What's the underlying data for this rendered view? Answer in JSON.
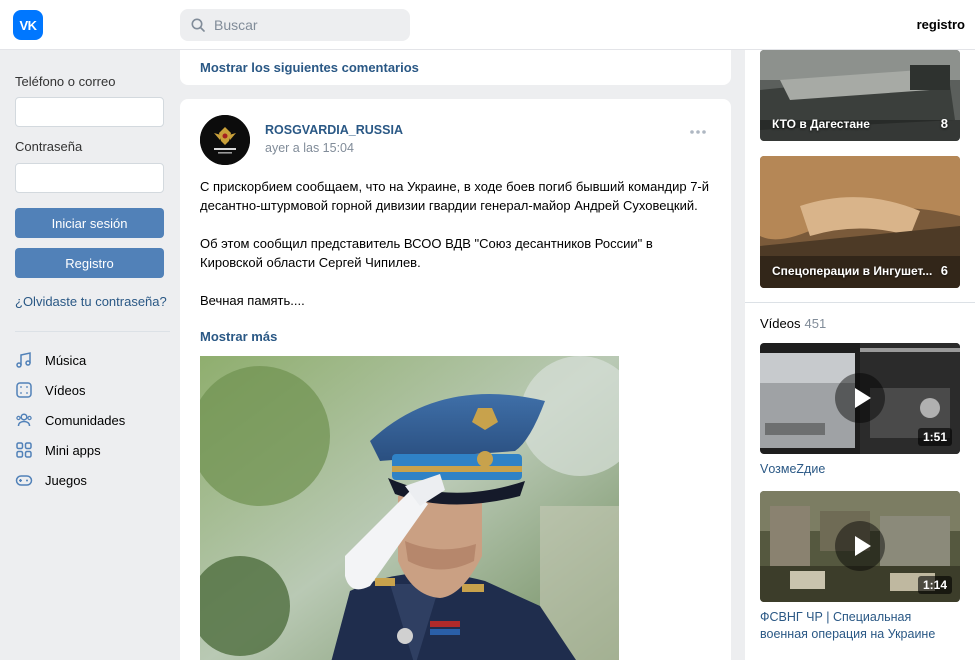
{
  "header": {
    "logo_text": "VK",
    "search_placeholder": "Buscar",
    "register_link": "registro"
  },
  "login": {
    "phone_label": "Teléfono o correo",
    "password_label": "Contraseña",
    "login_button": "Iniciar sesión",
    "register_button": "Registro",
    "forgot_link": "¿Olvidaste tu contraseña?"
  },
  "nav": {
    "items": [
      {
        "label": "Música",
        "icon": "music-icon"
      },
      {
        "label": "Vídeos",
        "icon": "video-icon"
      },
      {
        "label": "Comunidades",
        "icon": "communities-icon"
      },
      {
        "label": "Mini apps",
        "icon": "mini-apps-icon"
      },
      {
        "label": "Juegos",
        "icon": "games-icon"
      }
    ]
  },
  "comments": {
    "show_more": "Mostrar los siguientes comentarios"
  },
  "post": {
    "author": "ROSGVARDIA_RUSSIA",
    "time": "ayer a las 15:04",
    "paragraphs": [
      "С прискорбием сообщаем, что на Украине, в ходе боев погиб бывший командир 7-й десантно-штурмовой горной дивизии гвардии генерал-майор Андрей Суховецкий.",
      "Об этом сообщил представитель ВСОО ВДВ \"Союз десантников России\" в Кировской области Сергей Чипилев.",
      "Вечная память...."
    ],
    "show_more": "Mostrar más"
  },
  "right": {
    "albums": [
      {
        "caption": "КТО в Дагестане",
        "count": "8"
      },
      {
        "caption": "Спецоперации в Ингушет...",
        "count": "6"
      }
    ],
    "videos_label": "Vídeos",
    "videos_count": "451",
    "videos": [
      {
        "title": "VозмеZдие",
        "duration": "1:51"
      },
      {
        "title": "ФСВНГ ЧР | Специальная военная операция на Украине",
        "duration": "1:14"
      }
    ]
  },
  "colors": {
    "accent": "#5181b8",
    "link": "#2a5885",
    "brand": "#0077ff",
    "background": "#edeef0"
  }
}
